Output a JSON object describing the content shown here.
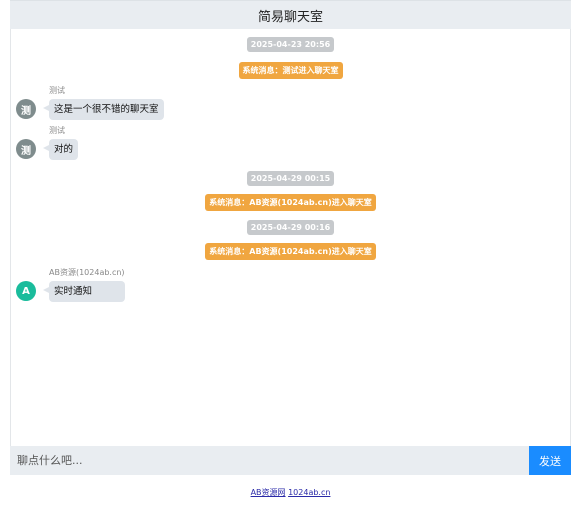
{
  "header": {
    "title": "简易聊天室"
  },
  "messages": [
    {
      "kind": "time",
      "text": "2025-04-23 20:56"
    },
    {
      "kind": "system",
      "text": "系统消息：测试进入聊天室"
    },
    {
      "kind": "user",
      "avatar": "测",
      "avatar_color": "#7f8c8d",
      "sender": "测试",
      "text": "这是一个很不错的聊天室"
    },
    {
      "kind": "user",
      "avatar": "测",
      "avatar_color": "#7f8c8d",
      "sender": "测试",
      "text": "对的"
    },
    {
      "kind": "time",
      "text": "2025-04-29 00:15"
    },
    {
      "kind": "system",
      "text": "系统消息：AB资源(1024ab.cn)进入聊天室"
    },
    {
      "kind": "time",
      "text": "2025-04-29 00:16"
    },
    {
      "kind": "system",
      "text": "系统消息：AB资源(1024ab.cn)进入聊天室"
    },
    {
      "kind": "user",
      "avatar": "A",
      "avatar_color": "#1abc9c",
      "sender": "AB资源(1024ab.cn)",
      "text": "实时通知"
    }
  ],
  "composer": {
    "placeholder": "聊点什么吧...",
    "send_label": "发送"
  },
  "footer": {
    "link1": "AB资源网",
    "link2": "1024ab.cn"
  },
  "colors": {
    "accent": "#1a8cff",
    "system": "#f0a640",
    "time": "#c6c9cc"
  }
}
